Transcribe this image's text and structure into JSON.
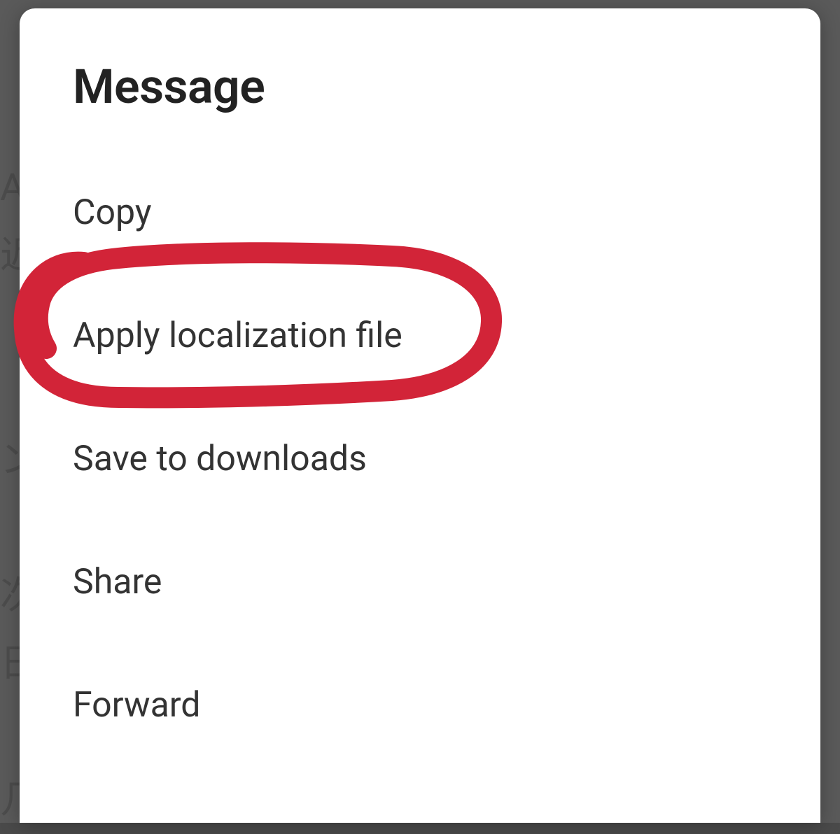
{
  "dialog": {
    "title": "Message",
    "items": [
      "Copy",
      "Apply localization file",
      "Save to downloads",
      "Share",
      "Forward"
    ]
  },
  "annotation": {
    "color": "#d22438",
    "target_index": 1
  },
  "backdrop": {
    "chars": "A\n近\n\n\nン\n\n次\n日\n\n几"
  }
}
